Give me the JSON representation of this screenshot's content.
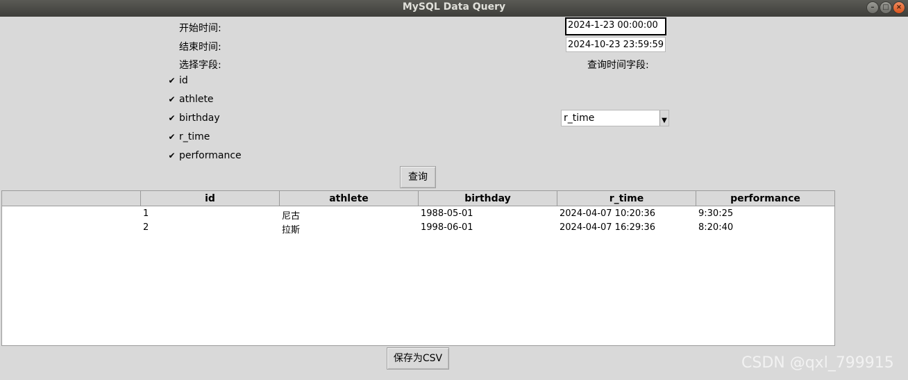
{
  "window": {
    "title": "MySQL Data Query"
  },
  "form": {
    "start_label": "开始时间:",
    "start_value": "2024-1-23 00:00:00",
    "end_label": "结束时间:",
    "end_value": "2024-10-23 23:59:59",
    "fields_label": "选择字段:",
    "time_field_label": "查询时间字段:",
    "fields": [
      {
        "label": "id",
        "checked": true
      },
      {
        "label": "athlete",
        "checked": true
      },
      {
        "label": "birthday",
        "checked": true
      },
      {
        "label": "r_time",
        "checked": true
      },
      {
        "label": "performance",
        "checked": true
      }
    ],
    "time_field_value": "r_time",
    "query_button": "查询"
  },
  "table": {
    "columns": [
      "id",
      "athlete",
      "birthday",
      "r_time",
      "performance"
    ],
    "rows": [
      [
        "1",
        "尼古",
        "1988-05-01",
        "2024-04-07 10:20:36",
        "9:30:25"
      ],
      [
        "2",
        "拉斯",
        "1998-06-01",
        "2024-04-07 16:29:36",
        "8:20:40"
      ]
    ]
  },
  "save_button": "保存为CSV",
  "watermark": "CSDN @qxl_799915"
}
